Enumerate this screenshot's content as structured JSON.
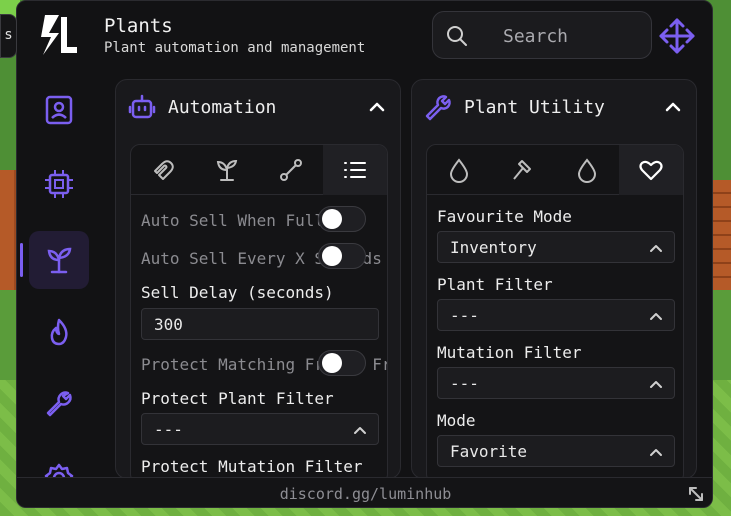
{
  "app": {
    "title": "Plants",
    "subtitle": "Plant automation and management"
  },
  "search": {
    "placeholder": "Search",
    "value": ""
  },
  "left_tab": {
    "glyph": "s"
  },
  "colors": {
    "accent": "#7b5ff0",
    "background": "#121214",
    "panel": "#19191c"
  },
  "sidebar": {
    "items": [
      {
        "icon": "user-card-icon",
        "active": false
      },
      {
        "icon": "chip-icon",
        "active": false
      },
      {
        "icon": "sprout-icon",
        "active": true
      },
      {
        "icon": "flame-icon",
        "active": false
      },
      {
        "icon": "wrench-icon",
        "active": false
      },
      {
        "icon": "gear-icon",
        "active": false
      }
    ]
  },
  "automation": {
    "title": "Automation",
    "icon": "robot-icon",
    "tabs": [
      "magnet-icon",
      "sprout-icon",
      "route-icon",
      "list-icon"
    ],
    "active_tab": 3,
    "auto_sell_full_label": "Auto Sell When Full",
    "auto_sell_full_on": false,
    "auto_sell_every_label": "Auto Sell Every X Seconds",
    "auto_sell_every_on": false,
    "sell_delay_label": "Sell Delay (seconds)",
    "sell_delay_value": "300",
    "protect_matching_label": "Protect Matching Fruits From",
    "protect_matching_on": false,
    "protect_plant_filter_label": "Protect Plant Filter",
    "protect_plant_filter_value": "---",
    "protect_mutation_filter_label": "Protect Mutation Filter"
  },
  "plant_utility": {
    "title": "Plant Utility",
    "icon": "wrench-icon",
    "tabs": [
      "drop-icon",
      "hammer-icon",
      "drop-icon",
      "heart-icon"
    ],
    "active_tab": 3,
    "favourite_mode_label": "Favourite Mode",
    "favourite_mode_value": "Inventory",
    "plant_filter_label": "Plant Filter",
    "plant_filter_value": "---",
    "mutation_filter_label": "Mutation Filter",
    "mutation_filter_value": "---",
    "mode_label": "Mode",
    "mode_value": "Favorite"
  },
  "footer": {
    "text": "discord.gg/luminhub"
  }
}
